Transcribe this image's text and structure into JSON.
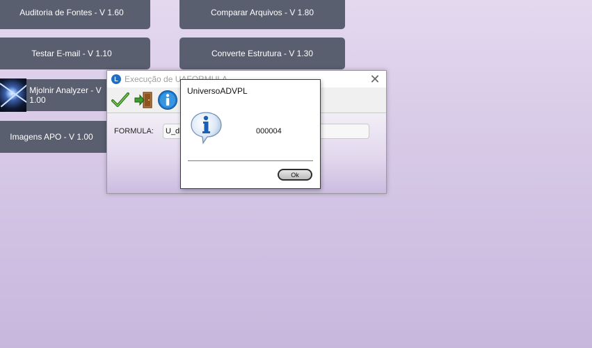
{
  "tiles": {
    "auditoria": "Auditoria de Fontes - V 1.60",
    "comparar": "Comparar Arquivos - V 1.80",
    "testar": "Testar E-mail - V 1.10",
    "converte": "Converte Estrutura - V 1.30",
    "mjolnir": "Mjolnir Analyzer - V 1.00",
    "imagens": "Imagens APO - V 1.00"
  },
  "exec_window": {
    "title": "Execução de UAFORMULA",
    "toolbar": [
      "confirm-check-icon",
      "exit-door-icon",
      "info-icon"
    ],
    "formula_label": "FORMULA:",
    "formula_value": "U_dbt"
  },
  "message_dialog": {
    "title": "UniversoADVPL",
    "message": "000004",
    "ok_label": "Ok",
    "icon": "info-icon"
  },
  "colors": {
    "tile_bg": "#5a5f70",
    "background": "#d6c8e6",
    "info_blue": "#1e6fc2"
  }
}
